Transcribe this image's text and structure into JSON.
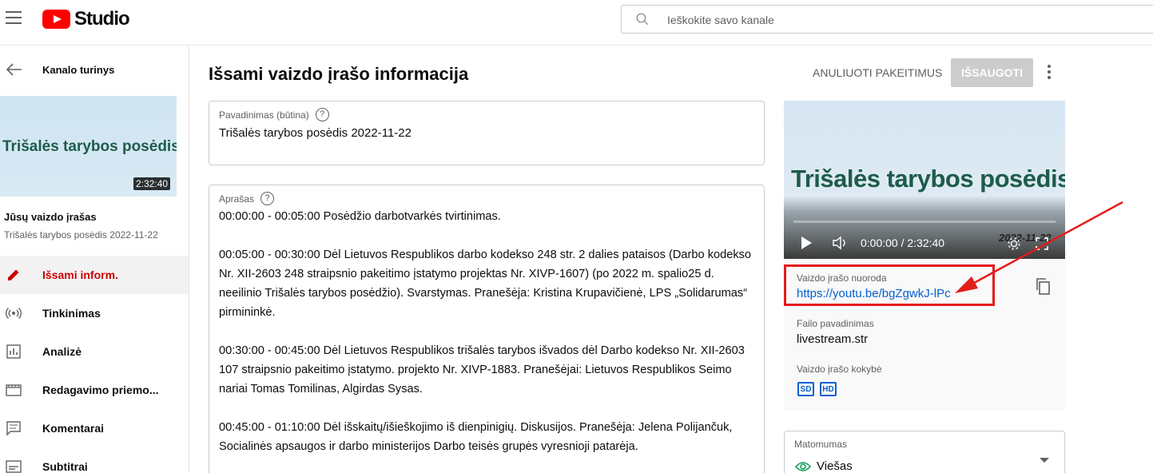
{
  "header": {
    "logo_text": "Studio",
    "search_placeholder": "Ieškokite savo kanale"
  },
  "sidebar": {
    "back_label": "Kanalo turinys",
    "thumbnail_title": "Trišalės tarybos posėdis",
    "duration": "2:32:40",
    "video_label": "Jūsų vaizdo įrašas",
    "video_title": "Trišalės tarybos posėdis 2022-11-22",
    "items": [
      {
        "label": "Išsami inform.",
        "icon": "pencil-icon",
        "active": true
      },
      {
        "label": "Tinkinimas",
        "icon": "broadcast-icon",
        "active": false
      },
      {
        "label": "Analizė",
        "icon": "analytics-icon",
        "active": false
      },
      {
        "label": "Redagavimo priemo...",
        "icon": "film-strip-icon",
        "active": false
      },
      {
        "label": "Komentarai",
        "icon": "comment-icon",
        "active": false
      },
      {
        "label": "Subtitrai",
        "icon": "subtitles-icon",
        "active": false
      }
    ]
  },
  "main": {
    "page_title": "Išsami vaizdo įrašo informacija",
    "undo_label": "ANULIUOTI PAKEITIMUS",
    "save_label": "IŠSAUGOTI",
    "title_field": {
      "label": "Pavadinimas (būtina)",
      "value": "Trišalės tarybos posėdis 2022-11-22"
    },
    "description_field": {
      "label": "Aprašas",
      "paragraphs": [
        "00:00:00 - 00:05:00 Posėdžio darbotvarkės tvirtinimas.",
        "00:05:00 - 00:30:00 Dėl Lietuvos Respublikos darbo kodekso 248 str. 2 dalies pataisos (Darbo kodekso Nr. XII-2603 248 straipsnio pakeitimo įstatymo projektas Nr. XIVP-1607) (po 2022 m. spalio25 d. neeilinio Trišalės tarybos posėdžio). Svarstymas. Pranešėja: Kristina Krupavičienė, LPS „Solidarumas“ pirmininkė.",
        "00:30:00 - 00:45:00 Dėl Lietuvos Respublikos trišalės tarybos išvados dėl Darbo kodekso Nr. XII-2603 107 straipsnio pakeitimo įstatymo. projekto Nr. XIVP-1883. Pranešėjai: Lietuvos Respublikos Seimo nariai Tomas Tomilinas, Algirdas Sysas.",
        "00:45:00 - 01:10:00 Dėl išskaitų/išieškojimo iš dienpinigių. Diskusijos. Pranešėja: Jelena Polijančuk, Socialinės apsaugos ir darbo ministerijos Darbo teisės grupės vyresnioji patarėja."
      ]
    }
  },
  "video_panel": {
    "player_title": "Trišalės tarybos posėdis",
    "time": "0:00:00 / 2:32:40",
    "overlay_date": "2022-11-22",
    "link_label": "Vaizdo įrašo nuoroda",
    "link_url": "https://youtu.be/bgZgwkJ-lPc",
    "file_label": "Failo pavadinimas",
    "file_value": "livestream.str",
    "quality_label": "Vaizdo įrašo kokybė",
    "quality_badges": [
      "SD",
      "HD"
    ]
  },
  "visibility": {
    "label": "Matomumas",
    "value": "Viešas"
  },
  "colors": {
    "brand_red": "#ff0000",
    "link_blue": "#065fd4",
    "annotation_red": "#e31c1c",
    "active_red": "#cc0000",
    "eye_green": "#0f9d58"
  }
}
